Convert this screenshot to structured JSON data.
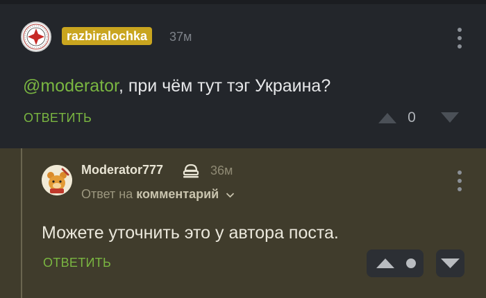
{
  "comment1": {
    "username": "razbiralochka",
    "time": "37м",
    "mention": "@moderator",
    "text": ", при чём тут тэг Украина?",
    "reply_label": "ОТВЕТИТЬ",
    "score": "0",
    "icons": {
      "avatar": "templar-cross-emblem",
      "upvote": "triangle-up-icon",
      "downvote": "triangle-down-icon",
      "menu": "kebab-menu-icon"
    }
  },
  "comment2": {
    "username": "Moderator777",
    "time": "36м",
    "reply_to_prefix": "Ответ на",
    "reply_to_link": "комментарий",
    "text": "Можете уточнить это у автора поста.",
    "reply_label": "ОТВЕТИТЬ",
    "icons": {
      "avatar": "cartoon-bear-avatar",
      "badge": "moderator-hat-icon",
      "upvote": "triangle-up-icon",
      "downvote": "triangle-down-icon",
      "score_dot": "dot-icon",
      "menu": "kebab-menu-icon"
    }
  },
  "colors": {
    "background": "#23262b",
    "reply_background": "#403c2c",
    "accent_green": "#7ab641",
    "username_badge": "#c9a51f"
  }
}
